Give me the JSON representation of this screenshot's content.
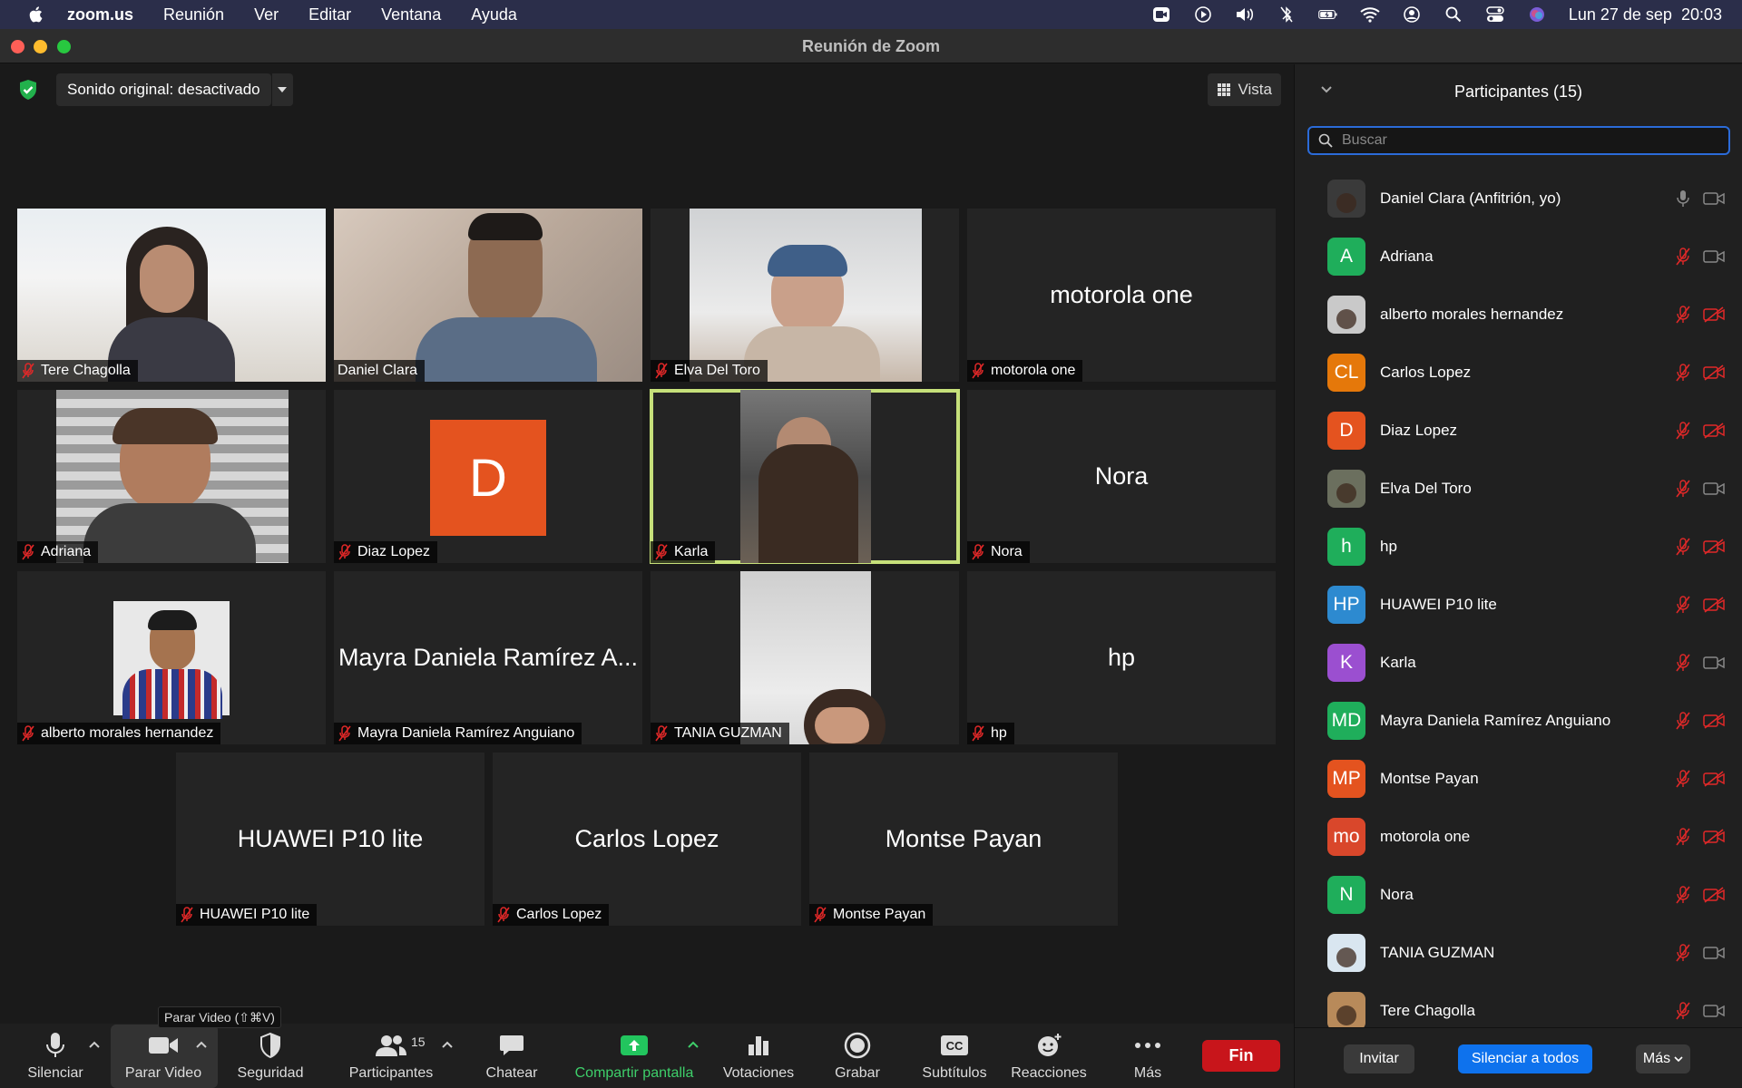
{
  "menubar": {
    "app": "zoom.us",
    "items": [
      "Reunión",
      "Ver",
      "Editar",
      "Ventana",
      "Ayuda"
    ],
    "clock": "Lun 27 de sep  20:03"
  },
  "window": {
    "title": "Reunión de Zoom"
  },
  "stage": {
    "sound_label": "Sonido original: desactivado",
    "view_label": "Vista"
  },
  "tiles": [
    {
      "name": "Tere Chagolla",
      "big": ""
    },
    {
      "name": "Daniel Clara",
      "big": ""
    },
    {
      "name": "Elva Del Toro",
      "big": ""
    },
    {
      "name": "motorola one",
      "big": "motorola one"
    },
    {
      "name": "Adriana",
      "big": ""
    },
    {
      "name": "Diaz Lopez",
      "big": "",
      "initial": "D"
    },
    {
      "name": "Karla",
      "big": ""
    },
    {
      "name": "Nora",
      "big": "Nora"
    },
    {
      "name": "alberto morales hernandez",
      "big": ""
    },
    {
      "name": "Mayra Daniela Ramírez Anguiano",
      "big": "Mayra Daniela Ramírez A..."
    },
    {
      "name": "TANIA GUZMAN",
      "big": ""
    },
    {
      "name": "hp",
      "big": "hp"
    },
    {
      "name": "HUAWEI P10 lite",
      "big": "HUAWEI P10 lite"
    },
    {
      "name": "Carlos Lopez",
      "big": "Carlos Lopez"
    },
    {
      "name": "Montse Payan",
      "big": "Montse Payan"
    }
  ],
  "toolbar": {
    "silenciar": "Silenciar",
    "parar_video": "Parar Video",
    "tooltip": "Parar Video (⇧⌘V)",
    "seguridad": "Seguridad",
    "participantes": "Participantes",
    "participant_count": "15",
    "chatear": "Chatear",
    "compartir": "Compartir pantalla",
    "votaciones": "Votaciones",
    "grabar": "Grabar",
    "subtitulos": "Subtítulos",
    "subtitulos_badge": "CC",
    "reacciones": "Reacciones",
    "mas": "Más",
    "fin": "Fin"
  },
  "panel": {
    "title": "Participantes (15)",
    "search_placeholder": "Buscar",
    "participants": [
      {
        "name": "Daniel Clara (Anfitrión, yo)",
        "initials": "",
        "color": "#3a3a3a",
        "mic_on": true,
        "cam_on": true
      },
      {
        "name": "Adriana",
        "initials": "A",
        "color": "#1fae5b",
        "mic_on": false,
        "cam_on": true
      },
      {
        "name": "alberto morales hernandez",
        "initials": "",
        "color": "#c9c9c9",
        "mic_on": false,
        "cam_on": false
      },
      {
        "name": "Carlos Lopez",
        "initials": "CL",
        "color": "#e5780a",
        "mic_on": false,
        "cam_on": false
      },
      {
        "name": "Diaz Lopez",
        "initials": "D",
        "color": "#e4531f",
        "mic_on": false,
        "cam_on": false
      },
      {
        "name": "Elva Del Toro",
        "initials": "",
        "color": "#6b6f5e",
        "mic_on": false,
        "cam_on": true
      },
      {
        "name": "hp",
        "initials": "h",
        "color": "#1fae5b",
        "mic_on": false,
        "cam_on": false
      },
      {
        "name": "HUAWEI P10 lite",
        "initials": "HP",
        "color": "#2d8ad0",
        "mic_on": false,
        "cam_on": false
      },
      {
        "name": "Karla",
        "initials": "K",
        "color": "#9b4fd0",
        "mic_on": false,
        "cam_on": true
      },
      {
        "name": "Mayra Daniela Ramírez Anguiano",
        "initials": "MD",
        "color": "#1fae5b",
        "mic_on": false,
        "cam_on": false
      },
      {
        "name": "Montse Payan",
        "initials": "MP",
        "color": "#e4531f",
        "mic_on": false,
        "cam_on": false
      },
      {
        "name": "motorola one",
        "initials": "mo",
        "color": "#d9472b",
        "mic_on": false,
        "cam_on": false
      },
      {
        "name": "Nora",
        "initials": "N",
        "color": "#1fae5b",
        "mic_on": false,
        "cam_on": false
      },
      {
        "name": "TANIA GUZMAN",
        "initials": "",
        "color": "#d9e6f0",
        "mic_on": false,
        "cam_on": true
      },
      {
        "name": "Tere Chagolla",
        "initials": "",
        "color": "#b88a5a",
        "mic_on": false,
        "cam_on": true
      }
    ],
    "invitar": "Invitar",
    "silenciar_todos": "Silenciar a todos",
    "mas": "Más"
  }
}
